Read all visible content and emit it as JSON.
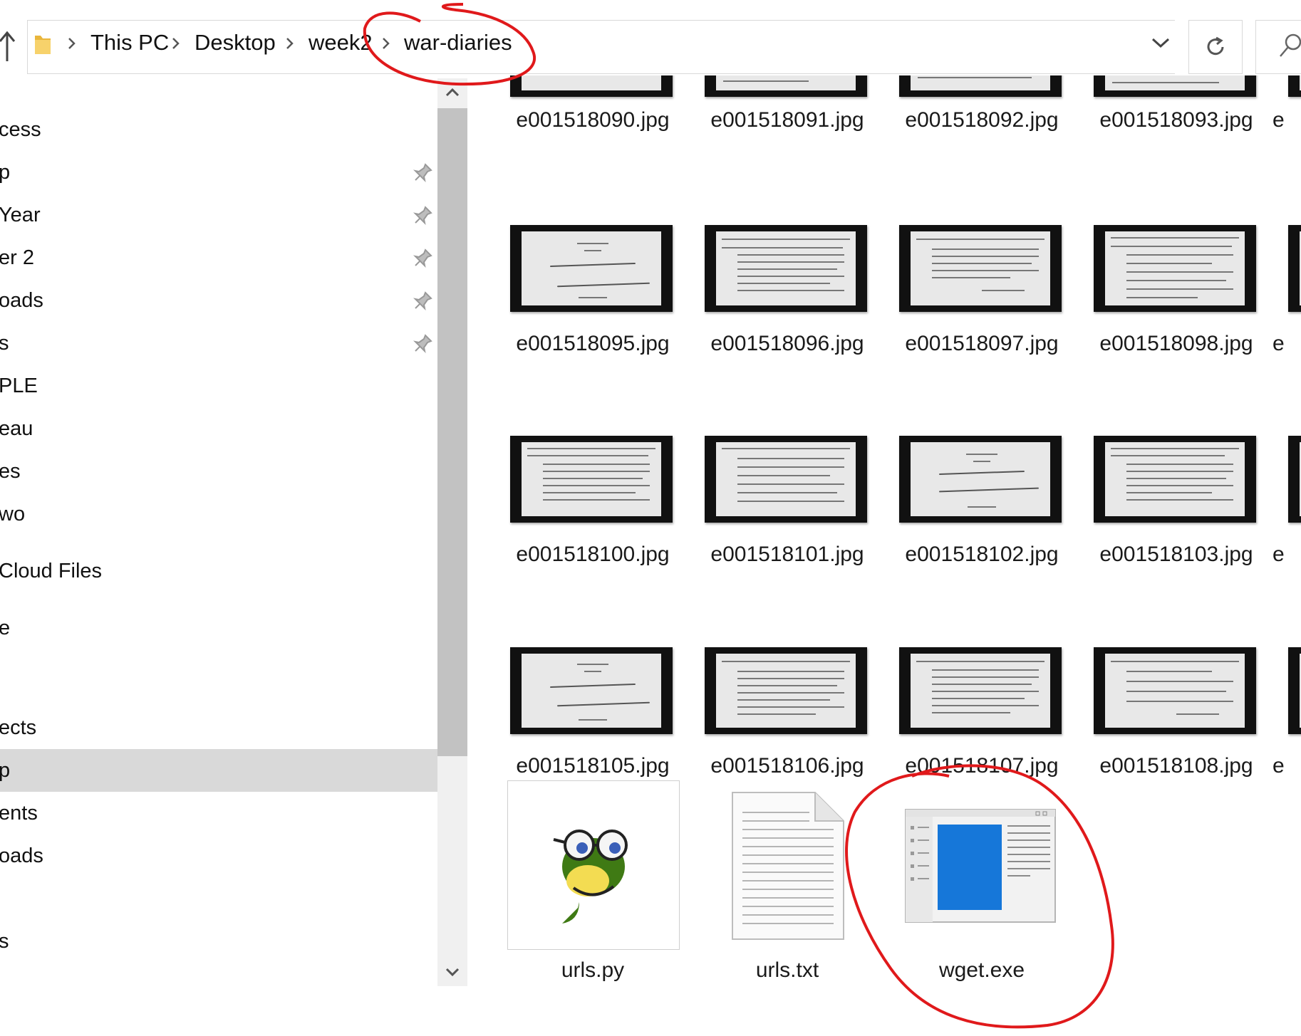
{
  "breadcrumb": {
    "items": [
      "This PC",
      "Desktop",
      "week2",
      "war-diaries"
    ]
  },
  "nav": {
    "items": [
      {
        "label": "cess",
        "pinned": false,
        "selected": false
      },
      {
        "label": "p",
        "pinned": true,
        "selected": false
      },
      {
        "label": " Year",
        "pinned": true,
        "selected": false
      },
      {
        "label": "er 2",
        "pinned": true,
        "selected": false
      },
      {
        "label": "oads",
        "pinned": true,
        "selected": false
      },
      {
        "label": "s",
        "pinned": true,
        "selected": false
      },
      {
        "label": "PLE",
        "pinned": false,
        "selected": false
      },
      {
        "label": "eau",
        "pinned": false,
        "selected": false
      },
      {
        "label": "es",
        "pinned": false,
        "selected": false
      },
      {
        "label": "wo",
        "pinned": false,
        "selected": false
      },
      {
        "label": "Cloud Files",
        "pinned": false,
        "selected": false
      },
      {
        "label": "e",
        "pinned": false,
        "selected": false
      },
      {
        "label": "ects",
        "pinned": false,
        "selected": false
      },
      {
        "label": "p",
        "pinned": false,
        "selected": true
      },
      {
        "label": "ents",
        "pinned": false,
        "selected": false
      },
      {
        "label": "oads",
        "pinned": false,
        "selected": false
      },
      {
        "label": "s",
        "pinned": false,
        "selected": false
      }
    ]
  },
  "files": {
    "row0": [
      "e001518090.jpg",
      "e001518091.jpg",
      "e001518092.jpg",
      "e001518093.jpg",
      "e"
    ],
    "row1": [
      "e001518095.jpg",
      "e001518096.jpg",
      "e001518097.jpg",
      "e001518098.jpg",
      "e"
    ],
    "row2": [
      "e001518100.jpg",
      "e001518101.jpg",
      "e001518102.jpg",
      "e001518103.jpg",
      "e"
    ],
    "row3": [
      "e001518105.jpg",
      "e001518106.jpg",
      "e001518107.jpg",
      "e001518108.jpg",
      "e"
    ],
    "row4": [
      "urls.py",
      "urls.txt",
      "wget.exe"
    ]
  },
  "icons": {
    "up": "up-arrow-icon",
    "folder": "folder-icon",
    "dropdown": "chevron-down-icon",
    "refresh": "refresh-icon",
    "search": "search-icon",
    "pin": "pin-icon",
    "python": "python-idle-icon",
    "text": "text-file-icon",
    "exe": "application-icon"
  },
  "colors": {
    "annotation": "#e0191b",
    "selected": "#d9d9d9",
    "exe_blue": "#1677d9"
  }
}
